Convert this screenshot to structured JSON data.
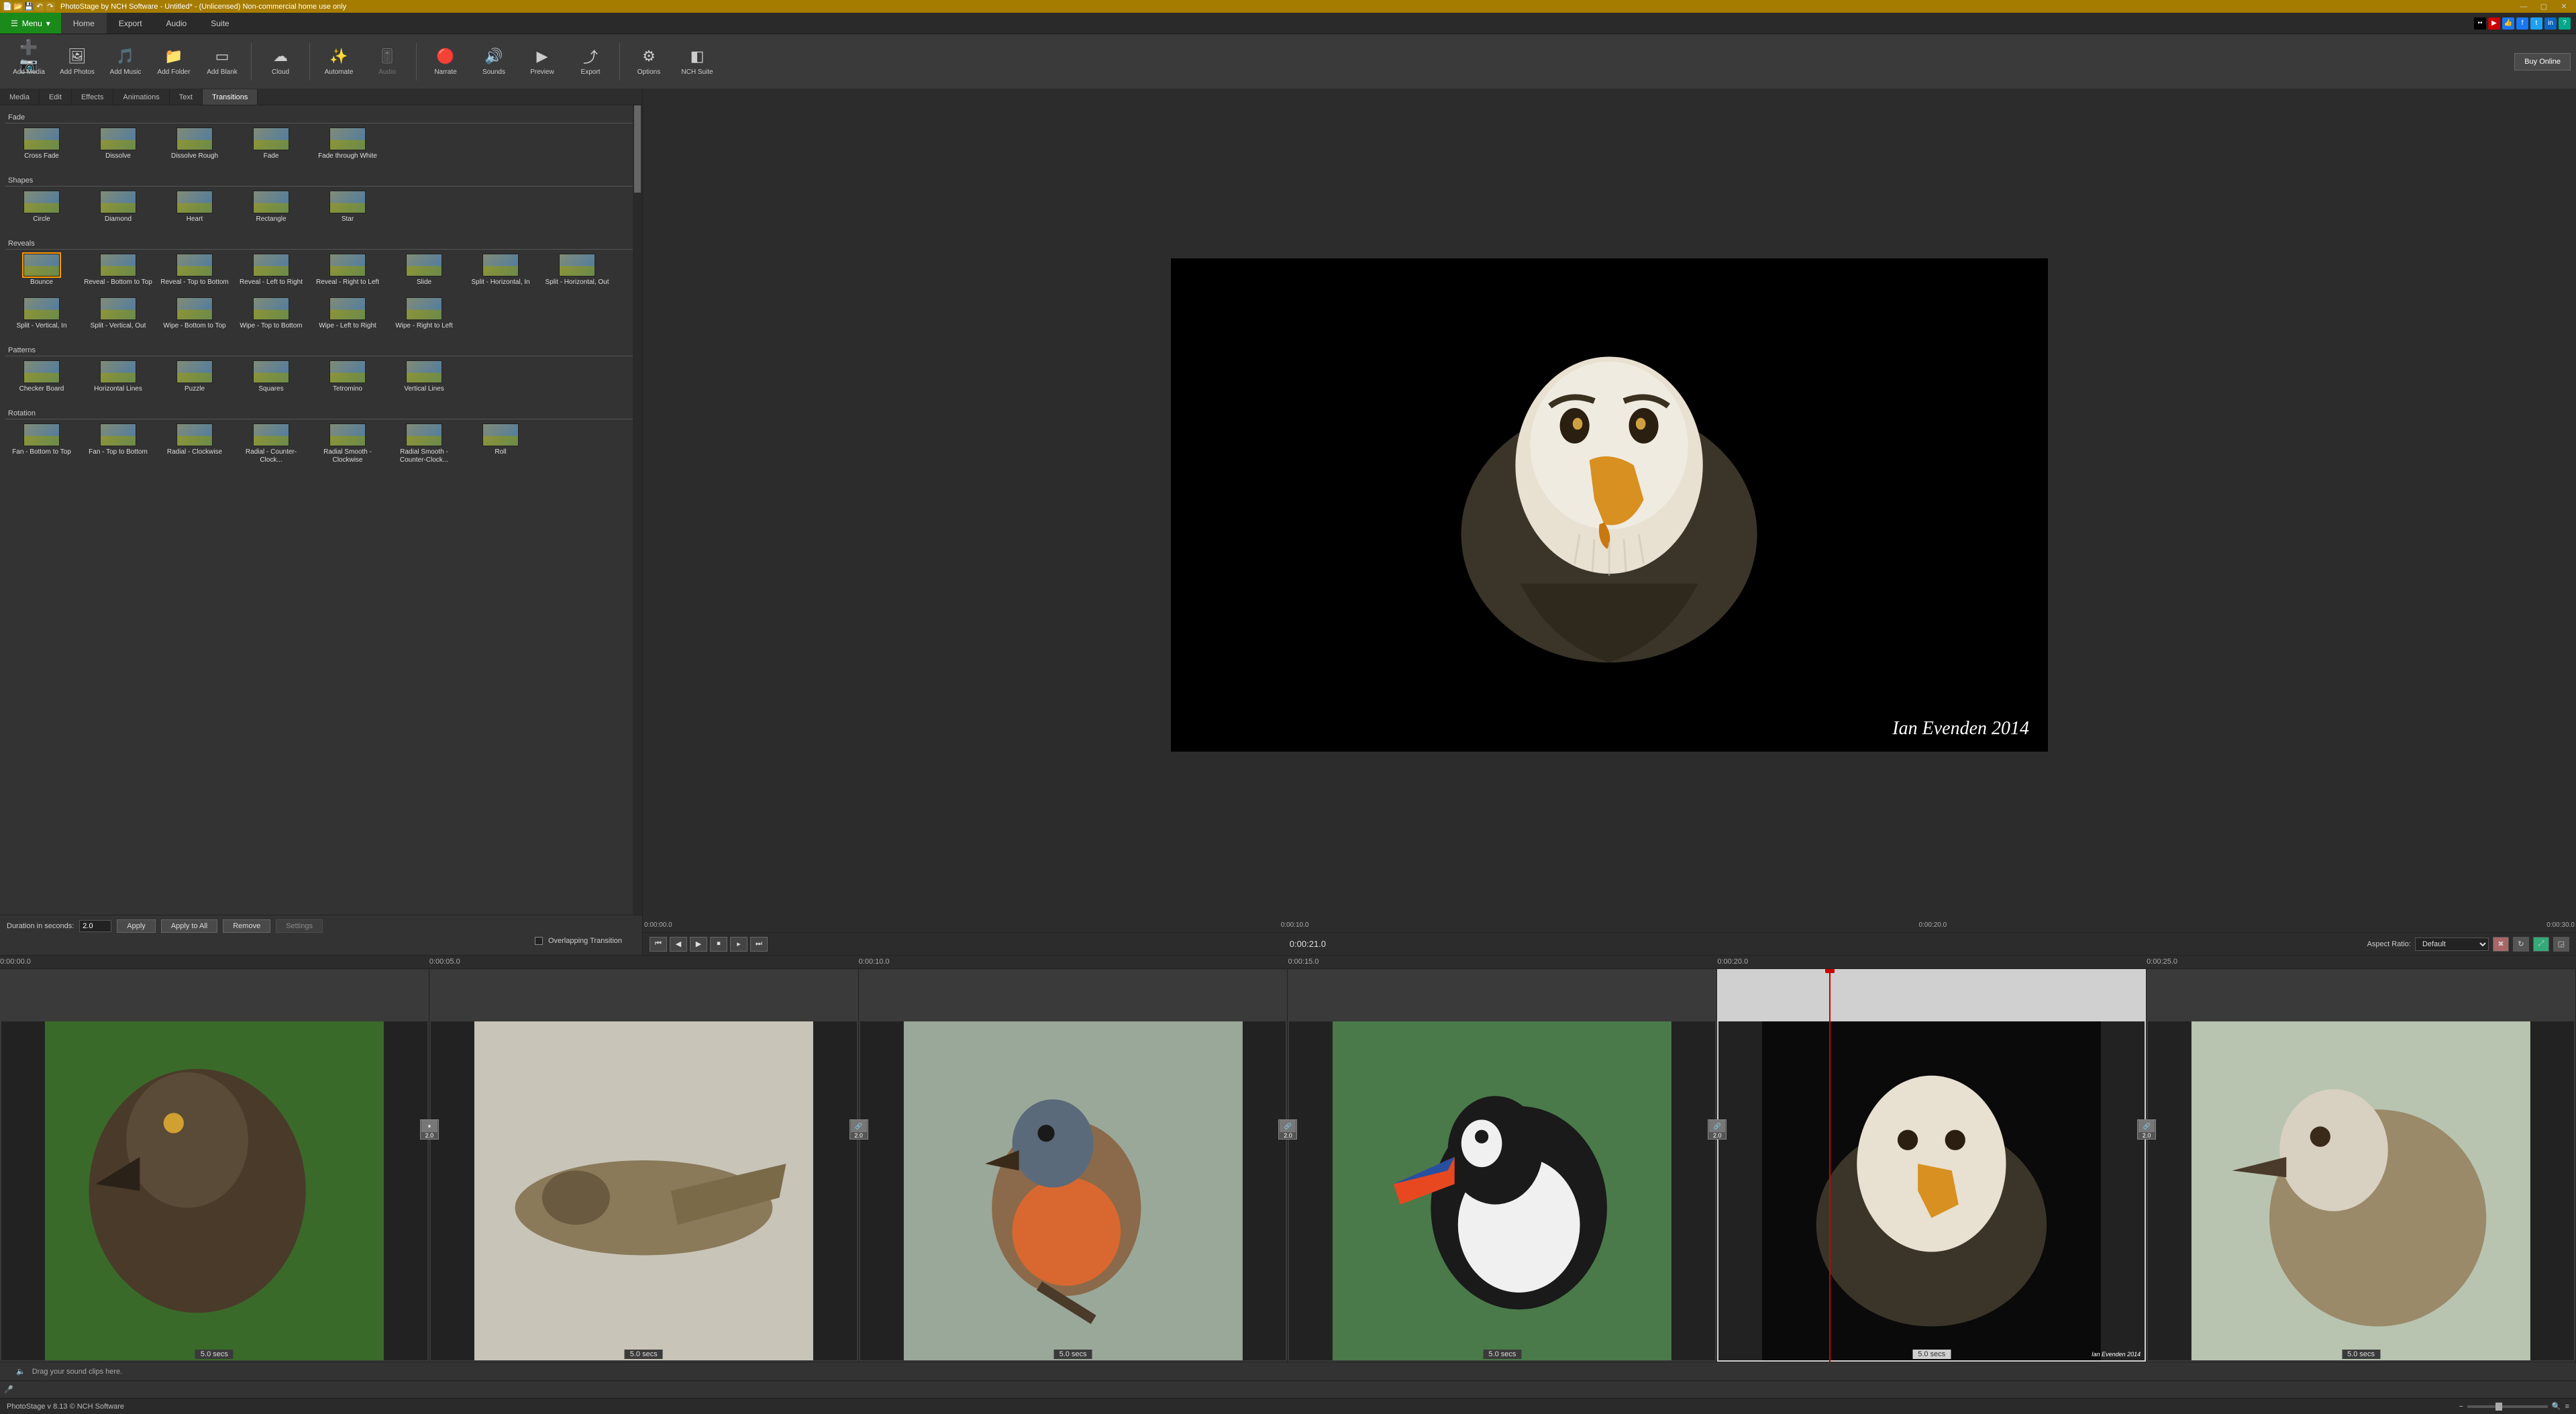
{
  "title_bar": {
    "app_title": "PhotoStage by NCH Software - Untitled* - (Unlicensed) Non-commercial home use only"
  },
  "menu": {
    "menu_button": "Menu",
    "tabs": [
      "Home",
      "Export",
      "Audio",
      "Suite"
    ],
    "active_tab": 0
  },
  "toolbar": {
    "buttons": [
      {
        "label": "Add Media",
        "icon": "➕📷"
      },
      {
        "label": "Add Photos",
        "icon": "🖼"
      },
      {
        "label": "Add Music",
        "icon": "🎵"
      },
      {
        "label": "Add Folder",
        "icon": "📁"
      },
      {
        "label": "Add Blank",
        "icon": "▭"
      },
      {
        "label": "Cloud",
        "icon": "☁"
      },
      {
        "label": "Automate",
        "icon": "✨"
      },
      {
        "label": "Audio",
        "icon": "🎚",
        "disabled": true
      },
      {
        "label": "Narrate",
        "icon": "🔴"
      },
      {
        "label": "Sounds",
        "icon": "🔊"
      },
      {
        "label": "Preview",
        "icon": "▶"
      },
      {
        "label": "Export",
        "icon": "⤴"
      },
      {
        "label": "Options",
        "icon": "⚙"
      },
      {
        "label": "NCH Suite",
        "icon": "◧"
      }
    ],
    "separators_after": [
      4,
      5,
      7,
      11
    ],
    "buy_online": "Buy Online"
  },
  "panel_tabs": {
    "tabs": [
      "Media",
      "Edit",
      "Effects",
      "Animations",
      "Text",
      "Transitions"
    ],
    "active": 5
  },
  "transitions": {
    "groups": [
      {
        "title": "Fade",
        "items": [
          "Cross Fade",
          "Dissolve",
          "Dissolve Rough",
          "Fade",
          "Fade through White"
        ]
      },
      {
        "title": "Shapes",
        "items": [
          "Circle",
          "Diamond",
          "Heart",
          "Rectangle",
          "Star"
        ]
      },
      {
        "title": "Reveals",
        "items": [
          "Bounce",
          "Reveal - Bottom to Top",
          "Reveal - Top to Bottom",
          "Reveal - Left to Right",
          "Reveal - Right to Left",
          "Slide",
          "Split - Horizontal, In",
          "Split - Horizontal, Out",
          "Split - Vertical, In",
          "Split - Vertical, Out",
          "Wipe - Bottom to Top",
          "Wipe - Top to Bottom",
          "Wipe - Left to Right",
          "Wipe - Right to Left"
        ],
        "selected": 0
      },
      {
        "title": "Patterns",
        "items": [
          "Checker Board",
          "Horizontal Lines",
          "Puzzle",
          "Squares",
          "Tetromino",
          "Vertical Lines"
        ]
      },
      {
        "title": "Rotation",
        "items": [
          "Fan - Bottom to Top",
          "Fan - Top to Bottom",
          "Radial - Clockwise",
          "Radial - Counter-Clock...",
          "Radial Smooth - Clockwise",
          "Radial Smooth - Counter-Clock...",
          "Roll"
        ]
      }
    ]
  },
  "duration": {
    "label": "Duration in seconds:",
    "value": "2.0",
    "apply": "Apply",
    "apply_all": "Apply to All",
    "remove": "Remove",
    "settings": "Settings",
    "overlap_label": "Overlapping Transition"
  },
  "preview": {
    "caption": "Ian Evenden 2014",
    "ruler": {
      "t0": "0:00:00.0",
      "t1": "0:00:10.0",
      "t2": "0:00:20.0",
      "t3": "0:00:30.0"
    },
    "current_time": "0:00:21.0",
    "aspect_label": "Aspect Ratio:",
    "aspect_value": "Default"
  },
  "timeline": {
    "ruler": [
      "0:00:00.0",
      "0:00:05.0",
      "0:00:10.0",
      "0:00:15.0",
      "0:00:20.0",
      "0:00:25.0"
    ],
    "clips": [
      {
        "duration": "5.0 secs",
        "transition": null
      },
      {
        "duration": "5.0 secs",
        "transition": "2.0",
        "ticon": "⏸"
      },
      {
        "duration": "5.0 secs",
        "transition": "2.0",
        "ticon": "🔗"
      },
      {
        "duration": "5.0 secs",
        "transition": "2.0",
        "ticon": "🔗"
      },
      {
        "duration": "5.0 secs",
        "transition": "2.0",
        "ticon": "🔗",
        "selected": true,
        "caption": "Ian Evenden 2014"
      },
      {
        "duration": "5.0 secs",
        "transition": "2.0",
        "ticon": "🔗"
      }
    ],
    "sound_hint": "Drag your sound clips here.",
    "playhead_percent": 71
  },
  "status": {
    "text": "PhotoStage v 8.13  © NCH Software"
  }
}
